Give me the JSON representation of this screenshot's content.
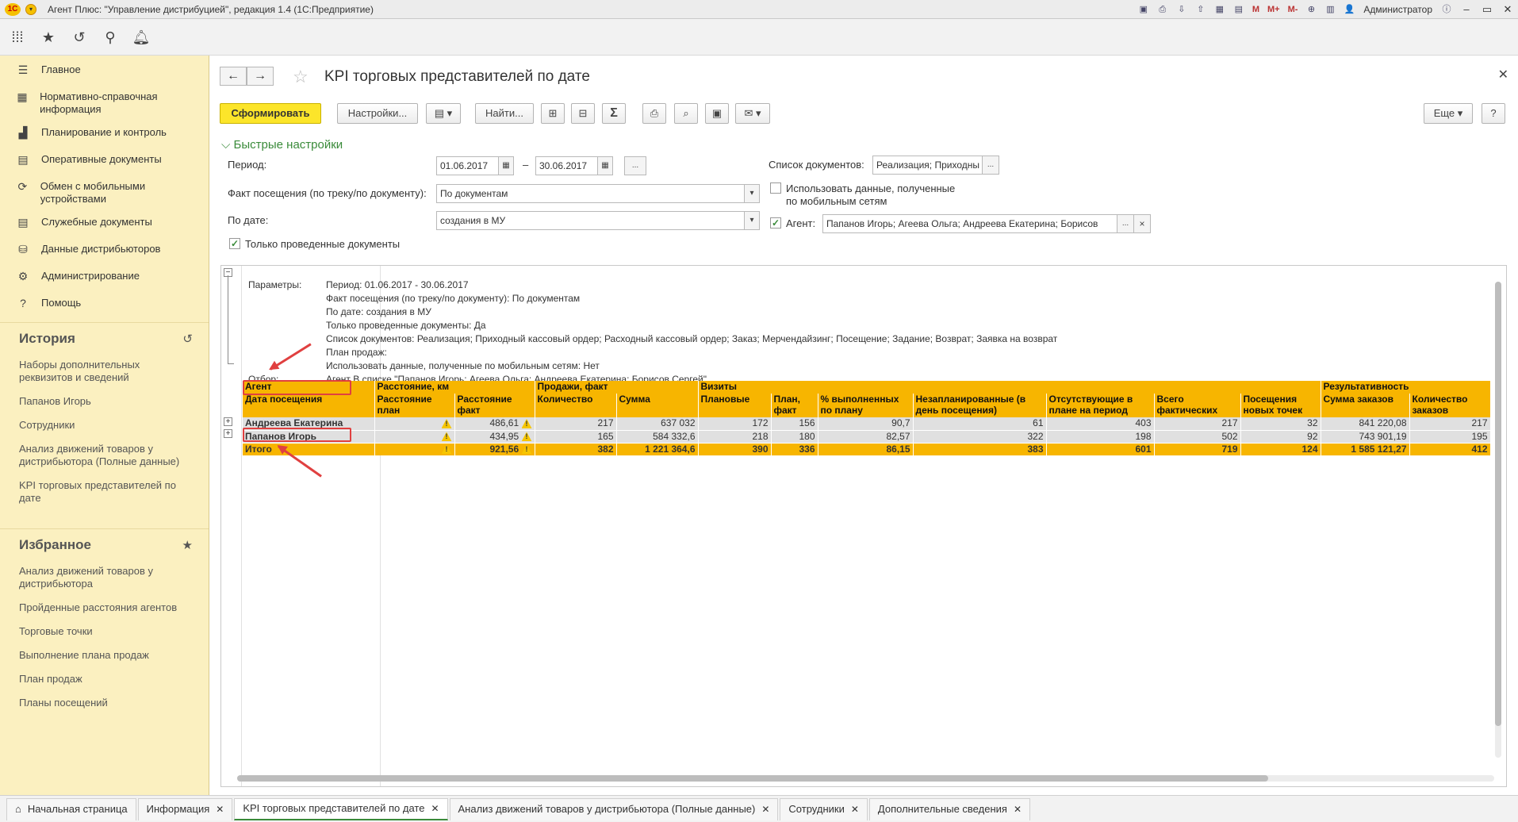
{
  "app": {
    "title": "Агент Плюс: \"Управление дистрибуцией\", редакция 1.4  (1С:Предприятие)",
    "logo_text": "1С",
    "user": "Администратор",
    "top_icons": [
      "save-icon",
      "print-icon",
      "download-icon",
      "upload-icon",
      "table-icon",
      "calendar-icon"
    ],
    "memory_buttons": [
      "M",
      "M+",
      "M-"
    ]
  },
  "sidebar": {
    "nav": [
      {
        "label": "Главное",
        "icon": "menu-lines-icon"
      },
      {
        "label": "Нормативно-справочная информация",
        "icon": "grid-icon"
      },
      {
        "label": "Планирование и контроль",
        "icon": "chart-icon"
      },
      {
        "label": "Оперативные документы",
        "icon": "documents-icon"
      },
      {
        "label": "Обмен с мобильными устройствами",
        "icon": "sync-icon"
      },
      {
        "label": "Служебные документы",
        "icon": "documents-icon"
      },
      {
        "label": "Данные дистрибьюторов",
        "icon": "database-icon"
      },
      {
        "label": "Администрирование",
        "icon": "gear-icon"
      },
      {
        "label": "Помощь",
        "icon": "question-icon"
      }
    ],
    "history_title": "История",
    "history": [
      "Наборы дополнительных реквизитов и сведений",
      "Папанов Игорь",
      "Сотрудники",
      "Анализ движений товаров у дистрибьютора (Полные данные)",
      "KPI торговых представителей по дате"
    ],
    "favorites_title": "Избранное",
    "favorites": [
      "Анализ движений товаров у дистрибьютора",
      "Пройденные расстояния агентов",
      "Торговые точки",
      "Выполнение плана продаж",
      "План продаж",
      "Планы посещений"
    ]
  },
  "form": {
    "title": "KPI торговых представителей по дате",
    "buttons": {
      "generate": "Сформировать",
      "settings": "Настройки...",
      "find": "Найти...",
      "more": "Еще",
      "help": "?",
      "sum": "Σ"
    },
    "quick_settings": "Быстрые настройки",
    "period_label": "Период:",
    "period_from": "01.06.2017",
    "period_dash": "–",
    "period_to": "30.06.2017",
    "dots": "...",
    "visit_fact_label": "Факт посещения (по треку/по документу):",
    "visit_fact_value": "По документам",
    "by_date_label": "По дате:",
    "by_date_value": "создания в МУ",
    "only_posted_label": "Только проведенные документы",
    "doc_list_label": "Список документов:",
    "doc_list_value": "Реализация; Приходны",
    "use_mobile_label": "Использовать данные, полученные по мобильным сетям",
    "agent_label": "Агент:",
    "agent_value": "Папанов Игорь; Агеева Ольга; Андреева Екатерина; Борисов",
    "clear_x": "×"
  },
  "report": {
    "params_label": "Параметры:",
    "filter_label": "Отбор:",
    "params": [
      "Период: 01.06.2017 - 30.06.2017",
      "Факт посещения (по треку/по документу): По документам",
      "По дате: создания в МУ",
      "Только проведенные документы: Да",
      "Список документов: Реализация; Приходный кассовый ордер; Расходный кассовый ордер; Заказ; Мерчендайзинг; Посещение; Задание; Возврат; Заявка на возврат",
      "План продаж:",
      "Использовать данные, полученные по мобильным сетям: Нет",
      "Агент В списке \"Папанов Игорь; Агеева Ольга; Андреева Екатерина; Борисов Сергей\""
    ],
    "header_groups": {
      "agent": "Агент",
      "distance": "Расстояние, км",
      "sales": "Продажи, факт",
      "visits": "Визиты",
      "result": "Результативность"
    },
    "columns": [
      "Дата посещения",
      "Расстояние план",
      "Расстояние факт",
      "Количество",
      "Сумма",
      "Плановые",
      "План, факт",
      "% выполненных по плану",
      "Незапланированные (в день посещения)",
      "Отсутствующие в плане на период",
      "Всего фактических",
      "Посещения новых точек",
      "Сумма заказов",
      "Количество заказов"
    ],
    "warn_symbol": "!",
    "rows": [
      {
        "name": "Андреева Екатерина",
        "dist_fact": "486,61",
        "qty": "217",
        "sum": "637 032",
        "planned": "172",
        "plan_fact": "156",
        "pct": "90,7",
        "unplanned": "61",
        "absent": "403",
        "total": "217",
        "new_points": "32",
        "order_sum": "841 220,08",
        "order_qty": "217"
      },
      {
        "name": "Папанов Игорь",
        "dist_fact": "434,95",
        "qty": "165",
        "sum": "584 332,6",
        "planned": "218",
        "plan_fact": "180",
        "pct": "82,57",
        "unplanned": "322",
        "absent": "198",
        "total": "502",
        "new_points": "92",
        "order_sum": "743 901,19",
        "order_qty": "195"
      }
    ],
    "total": {
      "name": "Итого",
      "dist_fact": "921,56",
      "qty": "382",
      "sum": "1 221 364,6",
      "planned": "390",
      "plan_fact": "336",
      "pct": "86,15",
      "unplanned": "383",
      "absent": "601",
      "total": "719",
      "new_points": "124",
      "order_sum": "1 585 121,27",
      "order_qty": "412"
    }
  },
  "tabs": [
    {
      "label": "Начальная страница",
      "home": true
    },
    {
      "label": "Информация"
    },
    {
      "label": "KPI торговых представителей по дате",
      "active": true
    },
    {
      "label": "Анализ движений товаров у дистрибьютора (Полные данные)"
    },
    {
      "label": "Сотрудники"
    },
    {
      "label": "Дополнительные сведения"
    }
  ],
  "colors": {
    "accent_yellow": "#f7b500",
    "sidebar_bg": "#fbf0c0",
    "highlight_red": "#e04040",
    "green": "#3a8b3a"
  }
}
